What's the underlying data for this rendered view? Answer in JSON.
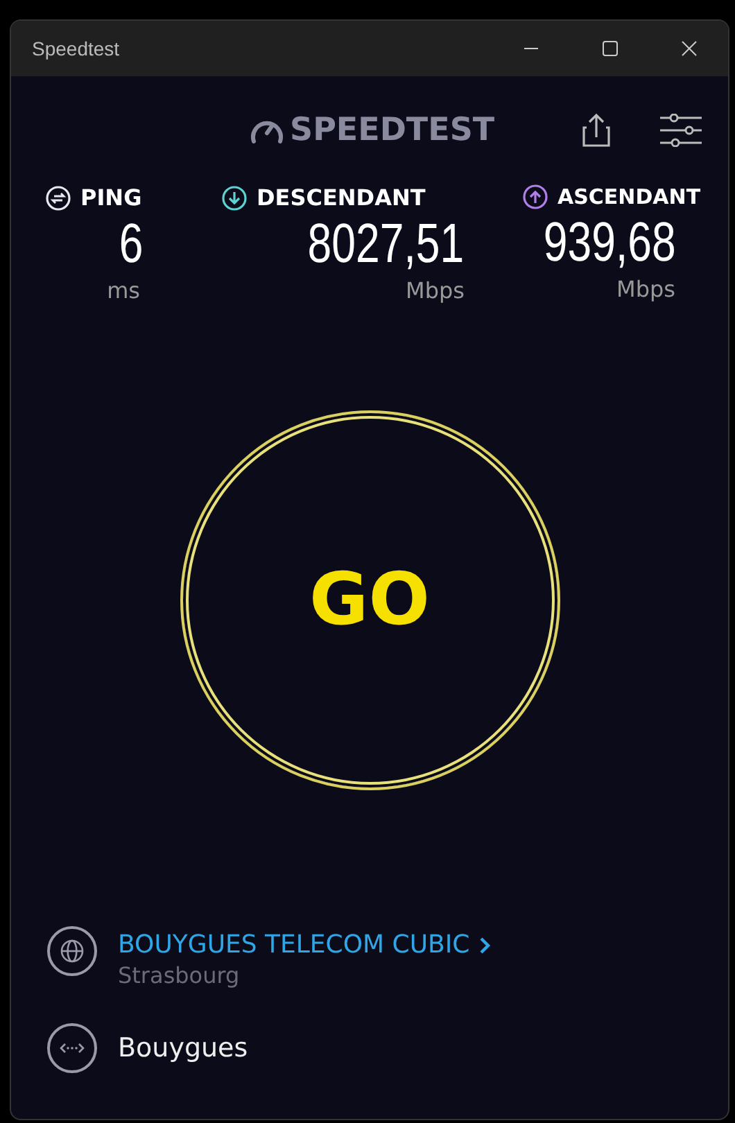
{
  "window": {
    "title": "Speedtest"
  },
  "logo": {
    "text": "SPEEDTEST"
  },
  "metrics": [
    {
      "kind": "ping",
      "label": "PING",
      "value": "6",
      "unit": "ms"
    },
    {
      "kind": "download",
      "label": "DESCENDANT",
      "value": "8027,51",
      "unit": "Mbps"
    },
    {
      "kind": "upload",
      "label": "ASCENDANT",
      "value": "939,68",
      "unit": "Mbps"
    }
  ],
  "go_button": {
    "label": "GO"
  },
  "server": {
    "name": "BOUYGUES TELECOM CUBIC",
    "location": "Strasbourg"
  },
  "provider": {
    "name": "Bouygues"
  }
}
